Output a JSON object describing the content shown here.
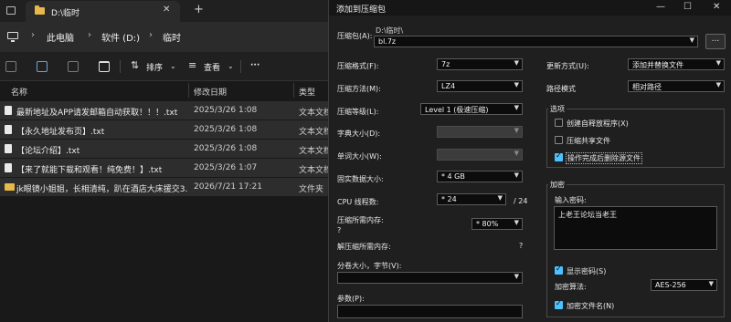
{
  "explorer": {
    "tab_title": "D:\\临时",
    "breadcrumbs": [
      "此电脑",
      "软件 (D:)",
      "临时"
    ],
    "toolbar": {
      "sort_label": "排序",
      "view_label": "查看",
      "more_label": "···"
    },
    "columns": {
      "name": "名称",
      "date": "修改日期",
      "type": "类型"
    },
    "files": [
      {
        "name": "最新地址及APP请发邮箱自动获取！！！.txt",
        "date": "2025/3/26 1:08",
        "type": "文本文档",
        "icon": "text-file-icon"
      },
      {
        "name": "【永久地址发布页】.txt",
        "date": "2025/3/26 1:08",
        "type": "文本文档",
        "icon": "text-file-icon"
      },
      {
        "name": "【论坛介绍】.txt",
        "date": "2025/3/26 1:08",
        "type": "文本文档",
        "icon": "text-file-icon"
      },
      {
        "name": "【来了就能下载和观看！纯免费！】.txt",
        "date": "2025/3/26 1:07",
        "type": "文本文档",
        "icon": "text-file-icon"
      },
      {
        "name": "jk眼镜小姐姐，长相清纯，趴在酒店大床援交3...",
        "date": "2026/7/21 17:21",
        "type": "文件夹",
        "icon": "folder-icon"
      }
    ]
  },
  "dialog": {
    "title": "添加到压缩包",
    "archive_label": "压缩包(A):",
    "archive_dir": "D:\\临时\\",
    "archive_name": "bl.7z",
    "browse_label": "...",
    "format_label": "压缩格式(F):",
    "format_value": "7z",
    "method_label": "压缩方法(M):",
    "method_value": "LZ4",
    "level_label": "压缩等级(L):",
    "level_value": "Level 1 (极速压缩)",
    "dict_label": "字典大小(D):",
    "word_label": "单词大小(W):",
    "solid_label": "固实数据大小:",
    "solid_value": "* 4 GB",
    "threads_label": "CPU 线程数:",
    "threads_value": "* 24",
    "threads_total": "/ 24",
    "mem_label": "压缩所需内存:",
    "mem_sub": "?",
    "mem_value": "* 80%",
    "decomp_label": "解压缩所需内存:",
    "decomp_value": "?",
    "split_label": "分卷大小，字节(V):",
    "params_label": "参数(P):",
    "update_label": "更新方式(U):",
    "update_value": "添加并替换文件",
    "path_label": "路径模式",
    "path_value": "相对路径",
    "options_title": "选项",
    "options": [
      {
        "label": "创建自释放程序(X)",
        "checked": false
      },
      {
        "label": "压缩共享文件",
        "checked": false
      },
      {
        "label": "操作完成后删除源文件",
        "checked": true
      }
    ],
    "encrypt_title": "加密",
    "password_label": "输入密码:",
    "password_value": "上老王论坛当老王",
    "show_password_label": "显示密码(S)",
    "encrypt_method_label": "加密算法:",
    "encrypt_method_value": "AES-256",
    "encrypt_names_label": "加密文件名(N)"
  }
}
